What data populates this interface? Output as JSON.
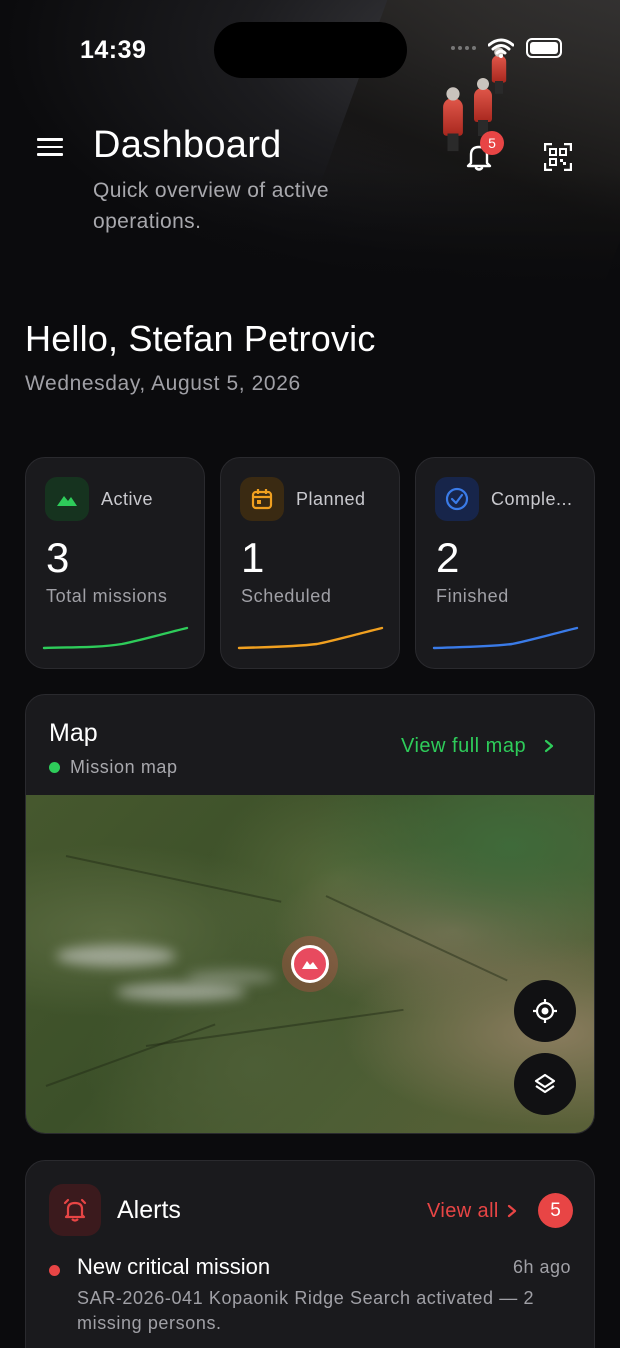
{
  "status_bar": {
    "time": "14:39"
  },
  "header": {
    "title": "Dashboard",
    "subtitle": "Quick overview of active operations.",
    "notifications_count": "5"
  },
  "greeting": {
    "hello": "Hello, Stefan Petrovic",
    "date": "Wednesday, August 5, 2026"
  },
  "stats": [
    {
      "label": "Active",
      "value": "3",
      "desc": "Total missions",
      "color": "#2ecc5a",
      "icon": "mountain-icon"
    },
    {
      "label": "Planned",
      "value": "1",
      "desc": "Scheduled",
      "color": "#f0a020",
      "icon": "calendar-icon"
    },
    {
      "label": "Comple...",
      "value": "2",
      "desc": "Finished",
      "color": "#3a7be8",
      "icon": "check-circle-icon"
    }
  ],
  "map": {
    "title": "Map",
    "subtitle": "Mission map",
    "view_full": "View full map"
  },
  "alerts": {
    "title": "Alerts",
    "view_all": "View all",
    "count": "5",
    "items": [
      {
        "title": "New critical mission",
        "time": "6h ago",
        "body": "SAR-2026-041 Kopaonik Ridge Search activated — 2 missing persons."
      }
    ]
  }
}
